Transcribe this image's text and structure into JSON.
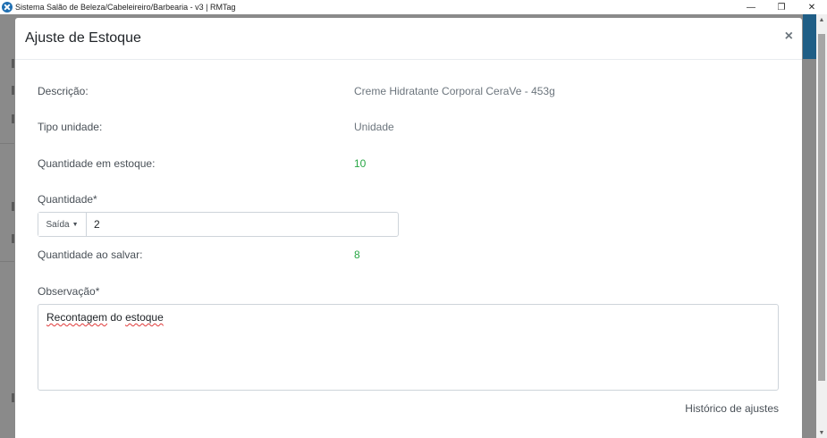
{
  "window": {
    "title": "Sistema Salão de Beleza/Cabeleireiro/Barbearia - v3 | RMTag",
    "minimize_glyph": "—",
    "restore_glyph": "❐",
    "close_glyph": "✕"
  },
  "modal": {
    "title": "Ajuste de Estoque",
    "close_glyph": "×",
    "fields": {
      "descricao_label": "Descrição:",
      "descricao_value": "Creme Hidratante Corporal CeraVe - 453g",
      "tipo_label": "Tipo unidade:",
      "tipo_value": "Unidade",
      "estoque_label": "Quantidade em estoque:",
      "estoque_value": "10",
      "quantidade_label": "Quantidade*",
      "movement_type": "Saída",
      "quantidade_value": "2",
      "ao_salvar_label": "Quantidade ao salvar:",
      "ao_salvar_value": "8",
      "observacao_label": "Observação*",
      "observacao_word1": "Recontagem",
      "observacao_word2": " do ",
      "observacao_word3": "estoque"
    },
    "history_link": "Histórico de ajustes"
  },
  "colors": {
    "accent_green": "#28a745",
    "header_strip": "#1f5e86"
  }
}
